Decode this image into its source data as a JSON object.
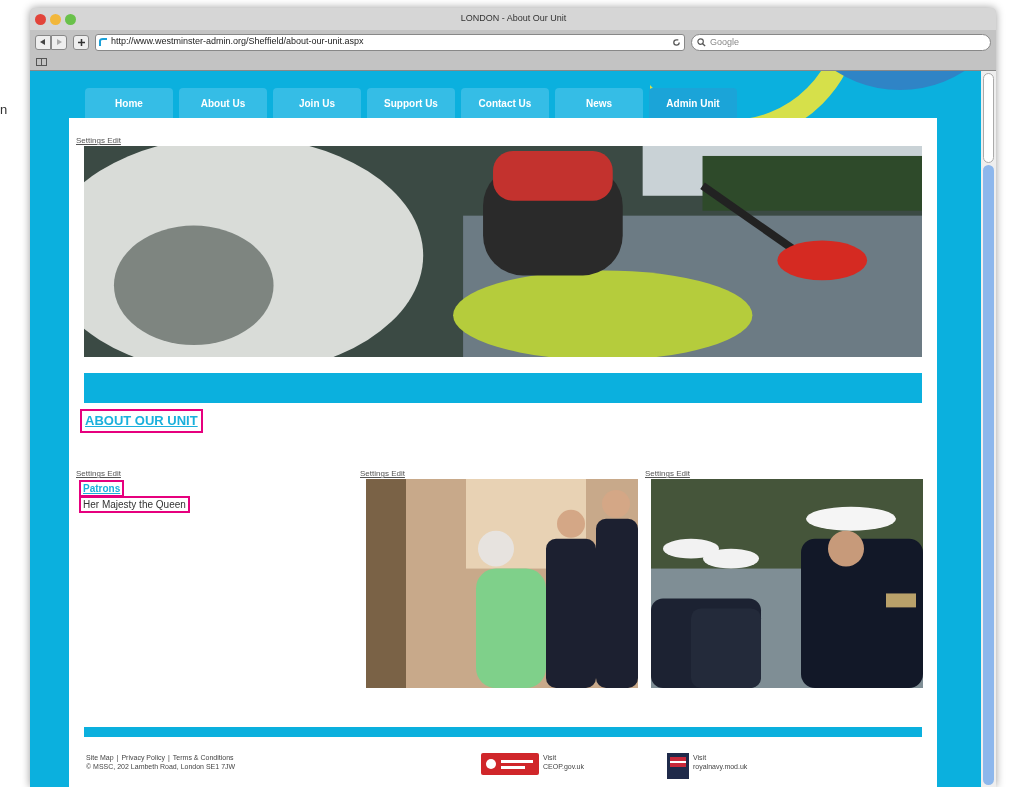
{
  "window": {
    "title": "LONDON - About Our Unit"
  },
  "toolbar": {
    "url": "http://www.westminster-admin.org/Sheffield/about-our-unit.aspx",
    "search": {
      "placeholder": "Google"
    }
  },
  "outside_text": "n",
  "nav": [
    {
      "label": "Home",
      "selected": false
    },
    {
      "label": "About Us",
      "selected": false
    },
    {
      "label": "Join Us",
      "selected": false
    },
    {
      "label": "Support Us",
      "selected": false
    },
    {
      "label": "Contact Us",
      "selected": false
    },
    {
      "label": "News",
      "selected": false
    },
    {
      "label": "Admin Unit",
      "selected": true
    }
  ],
  "hero": {
    "edit_link": "Settings Edit"
  },
  "heading": {
    "text": "ABOUT OUR UNIT",
    "highlighted": true
  },
  "patrons": {
    "edit_link": "Settings Edit",
    "title": {
      "text": "Patrons",
      "highlighted": true
    },
    "items": [
      {
        "text": "Her Majesty the Queen",
        "highlighted": true
      }
    ]
  },
  "photos": [
    {
      "edit_link": "Settings Edit"
    },
    {
      "edit_link": "Settings Edit"
    }
  ],
  "footer": {
    "links": [
      "Site Map",
      "Privacy Policy",
      "Terms & Conditions"
    ],
    "separators": [
      "|",
      "|"
    ],
    "address": "© MSSC, 202 Lambeth Road, London SE1 7JW",
    "partners": [
      {
        "kind": "ceop",
        "label": "Visit",
        "site": "CEOP.gov.uk"
      },
      {
        "kind": "navy",
        "label": "Visit",
        "site": "royalnavy.mod.uk"
      }
    ]
  }
}
